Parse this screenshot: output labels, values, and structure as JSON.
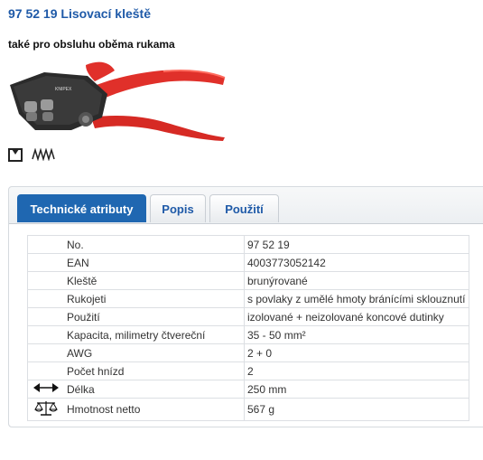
{
  "product": {
    "title": "97 52 19 Lisovací kleště",
    "subtitle": "také pro obsluhu oběma rukama",
    "image_icon": "crimping-pliers-image"
  },
  "features": {
    "icons": [
      "box-icon",
      "zigzag-icon"
    ]
  },
  "tabs": [
    {
      "label": "Technické atributy",
      "active": true
    },
    {
      "label": "Popis",
      "active": false
    },
    {
      "label": "Použití",
      "active": false
    }
  ],
  "attributes": [
    {
      "label": "No.",
      "value": "97 52 19",
      "icon": ""
    },
    {
      "label": "EAN",
      "value": "4003773052142",
      "icon": ""
    },
    {
      "label": "Kleště",
      "value": "brunýrované",
      "icon": ""
    },
    {
      "label": "Rukojeti",
      "value": "s povlaky z umělé hmoty bránícími sklouznutí",
      "icon": ""
    },
    {
      "label": "Použití",
      "value": "izolované + neizolované koncové dutinky",
      "icon": ""
    },
    {
      "label": "Kapacita, milimetry čtvereční",
      "value": "35 - 50 mm²",
      "icon": ""
    },
    {
      "label": "AWG",
      "value": "2 + 0",
      "icon": ""
    },
    {
      "label": "Počet hnízd",
      "value": "2",
      "icon": ""
    },
    {
      "label": "Délka",
      "value": "250 mm",
      "icon": "length-arrow-icon"
    },
    {
      "label": "Hmotnost netto",
      "value": "567 g",
      "icon": "scale-icon"
    }
  ],
  "colors": {
    "accent": "#1f67b1",
    "title": "#1f5aa8",
    "handle_red": "#e0302a"
  }
}
